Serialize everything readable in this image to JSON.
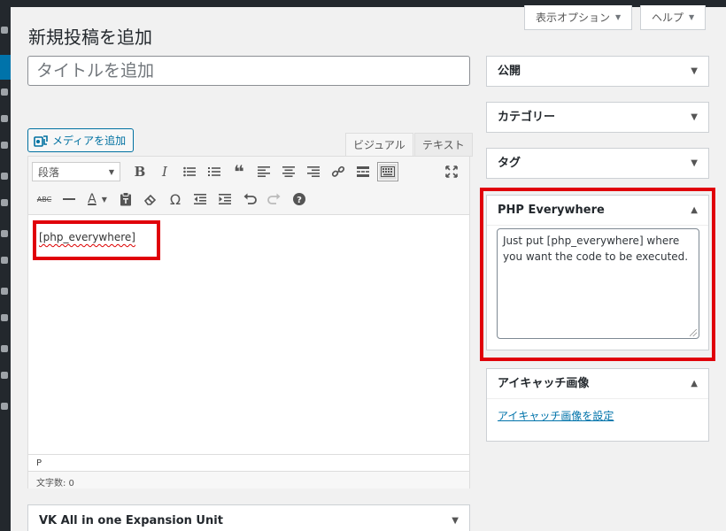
{
  "header": {
    "screen_options_label": "表示オプション",
    "help_label": "ヘルプ",
    "page_title": "新規投稿を追加"
  },
  "post": {
    "title_placeholder": "タイトルを追加"
  },
  "editor": {
    "media_button_label": "メディアを追加",
    "tab_visual": "ビジュアル",
    "tab_text": "テキスト",
    "format_select_value": "段落",
    "content_shortcode": "[php_everywhere]",
    "path_label": "P",
    "word_count_label": "文字数: 0"
  },
  "toolbar": {
    "row1_icons": [
      "bold-icon",
      "italic-icon",
      "bulleted-list-icon",
      "numbered-list-icon",
      "blockquote-icon",
      "align-left-icon",
      "align-center-icon",
      "align-right-icon",
      "link-icon",
      "read-more-icon",
      "toolbar-toggle-icon",
      "fullscreen-icon"
    ],
    "row2_icons": [
      "strikethrough-icon",
      "horizontal-rule-icon",
      "text-color-icon",
      "paste-as-text-icon",
      "clear-formatting-icon",
      "special-character-icon",
      "outdent-icon",
      "indent-icon",
      "undo-icon",
      "redo-icon",
      "help-icon"
    ],
    "strikethrough_glyph": "ABC",
    "textcolor_glyph": "A"
  },
  "sidebar": {
    "publish_title": "公開",
    "categories_title": "カテゴリー",
    "tags_title": "タグ",
    "php_box_title": "PHP Everywhere",
    "php_box_text": "Just put [php_everywhere] where you want the code to be executed.",
    "eyecatch_title": "アイキャッチ画像",
    "eyecatch_link": "アイキャッチ画像を設定"
  },
  "metabox": {
    "vk_title": "VK All in one Expansion Unit"
  },
  "colors": {
    "highlight_red": "#e0000a",
    "link_blue": "#0073aa",
    "admin_bar": "#23282d"
  }
}
